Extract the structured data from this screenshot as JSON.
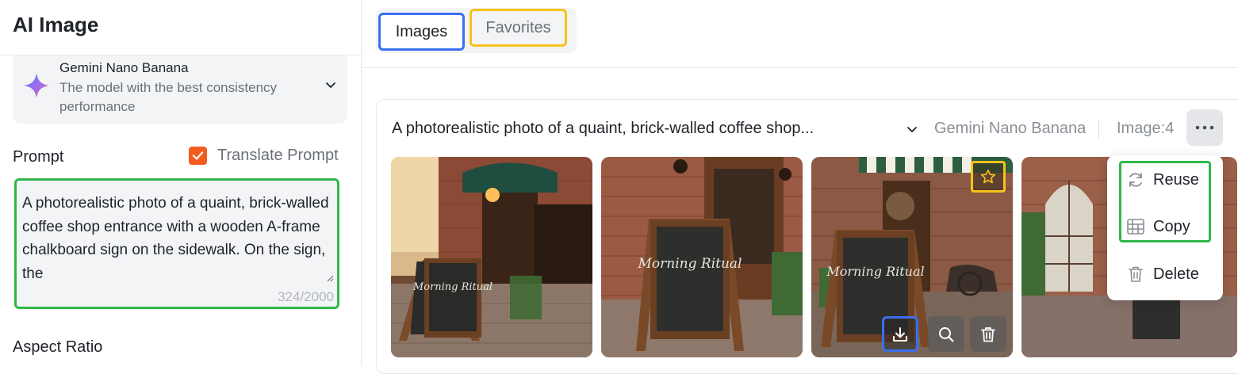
{
  "app": {
    "title": "AI Image"
  },
  "model": {
    "name": "Gemini Nano Banana",
    "description": "The model with the best consistency performance",
    "icon": "sparkle-icon"
  },
  "prompt": {
    "label": "Prompt",
    "translate_label": "Translate Prompt",
    "translate_checked": true,
    "text": "A photorealistic photo of a quaint, brick-walled coffee shop entrance with a wooden A-frame chalkboard sign on the sidewalk. On the sign, the",
    "count": "324/2000"
  },
  "aspect_ratio": {
    "label": "Aspect Ratio"
  },
  "tabs": [
    {
      "label": "Images",
      "active": true
    },
    {
      "label": "Favorites",
      "active": false
    }
  ],
  "card": {
    "title": "A photorealistic photo of a quaint, brick-walled coffee shop...",
    "model": "Gemini Nano Banana",
    "count": "Image:4",
    "images": [
      {
        "sign_text": "Morning Ritual"
      },
      {
        "sign_text": "Morning Ritual"
      },
      {
        "sign_text": "Morning Ritual",
        "favorited": false
      },
      {
        "sign_text": ""
      }
    ]
  },
  "menu": {
    "items": [
      {
        "label": "Reuse",
        "icon": "refresh-icon"
      },
      {
        "label": "Copy",
        "icon": "copy-icon"
      },
      {
        "label": "Delete",
        "icon": "trash-icon"
      }
    ]
  },
  "colors": {
    "accent_orange": "#f45b1f",
    "highlight_green": "#2fb84a",
    "highlight_blue": "#3a6ff0",
    "highlight_yellow": "#f9c21b"
  }
}
